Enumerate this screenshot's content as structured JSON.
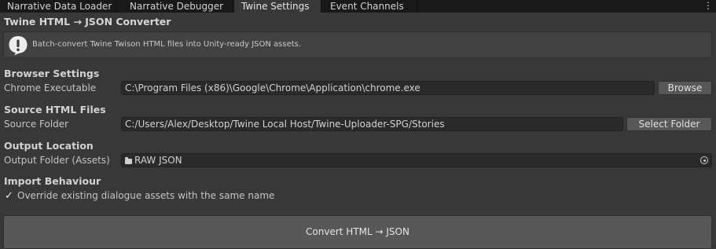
{
  "tabs": [
    {
      "label": "Narrative Data Loader",
      "active": false
    },
    {
      "label": "Narrative Debugger",
      "active": false
    },
    {
      "label": "Twine Settings",
      "active": true
    },
    {
      "label": "Event Channels",
      "active": false
    }
  ],
  "menu_icon": "⋮",
  "title": "Twine HTML → JSON Converter",
  "help": {
    "icon": "info-icon",
    "text": "Batch-convert Twine Twison HTML files into Unity-ready JSON assets."
  },
  "browser": {
    "heading": "Browser Settings",
    "label": "Chrome Executable",
    "value": "C:\\Program Files (x86)\\Google\\Chrome\\Application\\chrome.exe",
    "button": "Browse"
  },
  "source": {
    "heading": "Source HTML Files",
    "label": "Source Folder",
    "value": "C:/Users/Alex/Desktop/Twine Local Host/Twine-Uploader-SPG/Stories",
    "button": "Select Folder"
  },
  "output": {
    "heading": "Output Location",
    "label": "Output Folder (Assets)",
    "value": "RAW JSON",
    "field_icon": "folder-icon",
    "picker_icon": "object-picker-icon"
  },
  "import": {
    "heading": "Import Behaviour",
    "checkbox_checked": true,
    "checkbox_glyph": "✓",
    "checkbox_label": "Override existing dialogue assets with the same name"
  },
  "convert_button": "Convert HTML → JSON"
}
